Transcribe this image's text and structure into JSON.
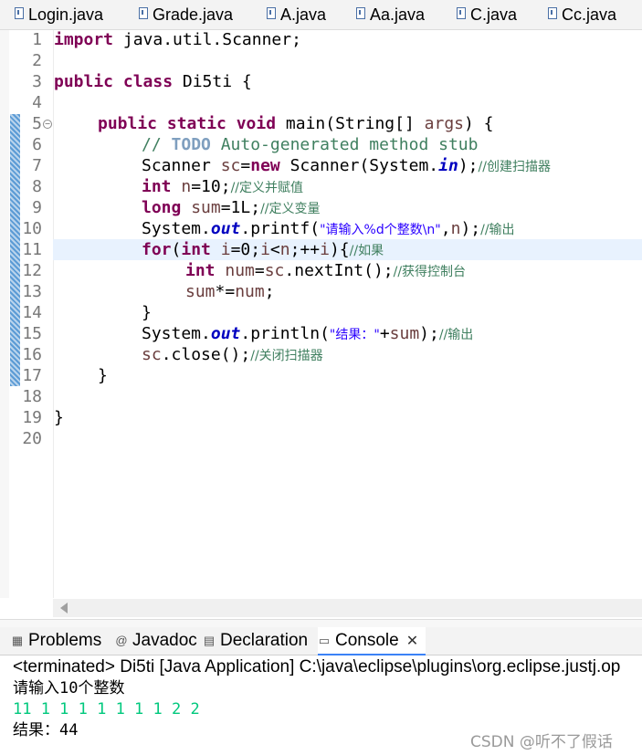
{
  "editor_tabs": [
    {
      "label": "Login.java"
    },
    {
      "label": "Grade.java"
    },
    {
      "label": "A.java"
    },
    {
      "label": "Aa.java"
    },
    {
      "label": "C.java"
    },
    {
      "label": "Cc.java"
    }
  ],
  "line_numbers": [
    "1",
    "2",
    "3",
    "4",
    "5",
    "6",
    "7",
    "8",
    "9",
    "10",
    "11",
    "12",
    "13",
    "14",
    "15",
    "16",
    "17",
    "18",
    "19",
    "20"
  ],
  "code": {
    "l1_kw": "import",
    "l1_rest": " java.util.Scanner;",
    "l3_kw": "public class",
    "l3_rest": " Di5ti {",
    "l5_kw": "public static void",
    "l5_rest": " main(String[] ",
    "l5_var": "args",
    "l5_end": ") {",
    "l6_comment_a": "// ",
    "l6_todo": "TODO",
    "l6_comment_b": " Auto-generated method stub",
    "l7_a": "Scanner ",
    "l7_var": "sc",
    "l7_b": "=",
    "l7_kw": "new",
    "l7_c": " Scanner(System.",
    "l7_fld": "in",
    "l7_d": ");",
    "l7_cm": "//创建扫描器",
    "l8_kw": "int",
    "l8_sp": " ",
    "l8_var": "n",
    "l8_rest": "=10;",
    "l8_cm": "//定义并赋值",
    "l9_kw": "long",
    "l9_sp": " ",
    "l9_var": "sum",
    "l9_rest": "=1L;",
    "l9_cm": "//定义变量",
    "l10_a": "System.",
    "l10_fld": "out",
    "l10_b": ".printf(",
    "l10_str": "\"请输入%d个整数\\n\"",
    "l10_c": ",",
    "l10_var": "n",
    "l10_d": ");",
    "l10_cm": "//输出",
    "l11_kw": "for",
    "l11_a": "(",
    "l11_kw2": "int",
    "l11_b": " ",
    "l11_var": "i",
    "l11_c": "=0;",
    "l11_var2": "i",
    "l11_d": "<",
    "l11_var3": "n",
    "l11_e": ";++",
    "l11_var4": "i",
    "l11_f": "){",
    "l11_cm": "//如果",
    "l12_kw": "int",
    "l12_sp": " ",
    "l12_var": "num",
    "l12_a": "=",
    "l12_var2": "sc",
    "l12_b": ".nextInt();",
    "l12_cm": "//获得控制台",
    "l13_var": "sum",
    "l13_a": "*=",
    "l13_var2": "num",
    "l13_b": ";",
    "l14": "}",
    "l15_a": "System.",
    "l15_fld": "out",
    "l15_b": ".println(",
    "l15_str": "\"结果：\"",
    "l15_c": "+",
    "l15_var": "sum",
    "l15_d": ");",
    "l15_cm": "//输出",
    "l16_var": "sc",
    "l16_a": ".close();",
    "l16_cm": "//关闭扫描器",
    "l17": "}",
    "l19": "}"
  },
  "bottom_tabs": [
    {
      "label": "Problems",
      "icon": "problems-icon"
    },
    {
      "label": "Javadoc",
      "icon": "javadoc-icon"
    },
    {
      "label": "Declaration",
      "icon": "declaration-icon"
    },
    {
      "label": "Console",
      "icon": "console-icon"
    }
  ],
  "console": {
    "status": "<terminated> Di5ti [Java Application] C:\\java\\eclipse\\plugins\\org.eclipse.justj.op",
    "line1": "请输入10个整数",
    "line2": "11 1 1 1 1 1 1 1 2 2",
    "line3": "结果：44"
  },
  "watermark": "CSDN @听不了假话",
  "colors": {
    "keyword": "#7f0055",
    "comment": "#3f7f5f",
    "string": "#2a00ff",
    "field": "#0000c0",
    "console_input": "#00c87d"
  }
}
